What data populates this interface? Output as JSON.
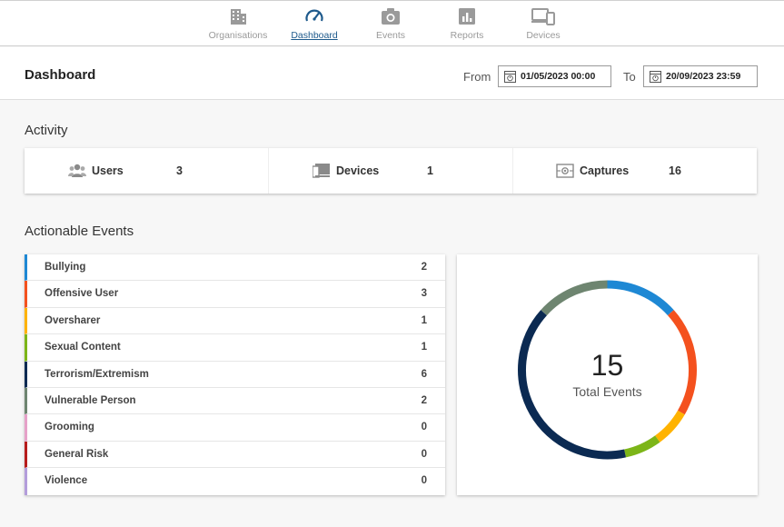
{
  "nav": {
    "items": [
      {
        "label": "Organisations",
        "icon": "building-icon",
        "active": false
      },
      {
        "label": "Dashboard",
        "icon": "speedometer-icon",
        "active": true
      },
      {
        "label": "Events",
        "icon": "camera-icon",
        "active": false
      },
      {
        "label": "Reports",
        "icon": "bar-chart-icon",
        "active": false
      },
      {
        "label": "Devices",
        "icon": "devices-icon",
        "active": false
      }
    ]
  },
  "header": {
    "title": "Dashboard",
    "from_label": "From",
    "from_value": "01/05/2023 00:00",
    "to_label": "To",
    "to_value": "20/09/2023 23:59"
  },
  "activity": {
    "title": "Activity",
    "cells": [
      {
        "label": "Users",
        "value": "3",
        "icon": "users-icon"
      },
      {
        "label": "Devices",
        "value": "1",
        "icon": "devices-icon"
      },
      {
        "label": "Captures",
        "value": "16",
        "icon": "capture-icon"
      }
    ]
  },
  "events": {
    "title": "Actionable Events",
    "rows": [
      {
        "label": "Bullying",
        "value": "2",
        "color": "#1e88d4"
      },
      {
        "label": "Offensive User",
        "value": "3",
        "color": "#f4511e"
      },
      {
        "label": "Oversharer",
        "value": "1",
        "color": "#ffb300"
      },
      {
        "label": "Sexual Content",
        "value": "1",
        "color": "#7cb518"
      },
      {
        "label": "Terrorism/Extremism",
        "value": "6",
        "color": "#0b2a52"
      },
      {
        "label": "Vulnerable Person",
        "value": "2",
        "color": "#6e8570"
      },
      {
        "label": "Grooming",
        "value": "0",
        "color": "#e6a1c8"
      },
      {
        "label": "General Risk",
        "value": "0",
        "color": "#b71c1c"
      },
      {
        "label": "Violence",
        "value": "0",
        "color": "#b39ddb"
      }
    ],
    "total": "15",
    "total_label": "Total Events"
  }
}
